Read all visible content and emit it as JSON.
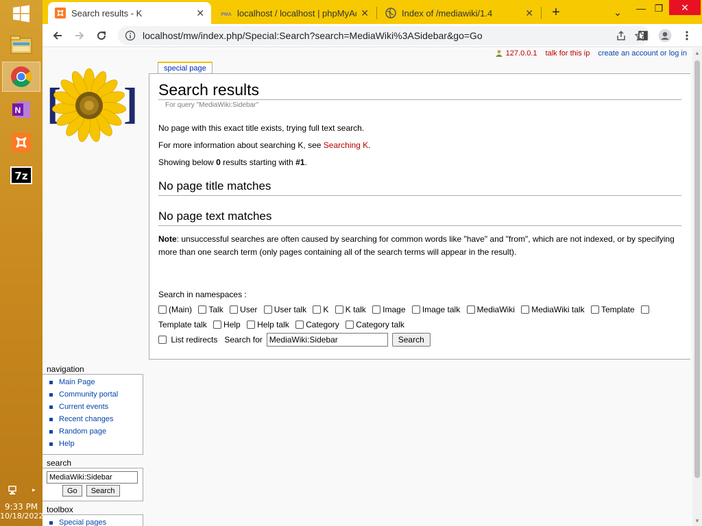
{
  "taskbar": {
    "time": "9:33 PM",
    "date": "10/18/2022",
    "apps": [
      {
        "name": "File Explorer",
        "icon": "file-explorer-icon"
      },
      {
        "name": "Google Chrome",
        "icon": "chrome-icon",
        "active": true
      },
      {
        "name": "OneNote",
        "icon": "onenote-icon"
      },
      {
        "name": "XAMPP",
        "icon": "xampp-icon"
      },
      {
        "name": "7-Zip",
        "icon": "7zip-icon",
        "label": "7z"
      }
    ]
  },
  "browser": {
    "tabs": [
      {
        "title": "Search results - K",
        "active": true
      },
      {
        "title": "localhost / localhost | phpMyAdmin",
        "active": false
      },
      {
        "title": "Index of /mediawiki/1.4",
        "active": false
      }
    ],
    "new_tab": "+",
    "address": "localhost/mw/index.php/Special:Search?search=MediaWiki%3ASidebar&go=Go"
  },
  "personal": {
    "ip": "127.0.0.1",
    "talk": "talk for this ip",
    "login": "create an account or log in"
  },
  "tab_label": "special page",
  "content": {
    "title": "Search results",
    "subtitle": "For query \"MediaWiki:Sidebar\"",
    "p1": "No page with this exact title exists, trying full text search.",
    "p2_prefix": "For more information about searching K, see ",
    "p2_link": "Searching K",
    "p2_suffix": ".",
    "p3_prefix": "Showing below ",
    "p3_count": "0",
    "p3_middle": " results starting with ",
    "p3_start": "#1",
    "p3_suffix": ".",
    "h_title": "No page title matches",
    "h_text": "No page text matches",
    "note_label": "Note",
    "note_text": ": unsuccessful searches are often caused by searching for common words like \"have\" and \"from\", which are not indexed, or by specifying more than one search term (only pages containing all of the search terms will appear in the result).",
    "ns_label": "Search in namespaces :",
    "namespaces": [
      "(Main)",
      "Talk",
      "User",
      "User talk",
      "K",
      "K talk",
      "Image",
      "Image talk",
      "MediaWiki",
      "MediaWiki talk",
      "Template",
      "Template talk",
      "Help",
      "Help talk",
      "Category",
      "Category talk"
    ],
    "list_redirects": "List redirects",
    "search_for": "Search for",
    "search_value": "MediaWiki:Sidebar",
    "search_button": "Search"
  },
  "sidebar": {
    "navigation_title": "navigation",
    "nav_items": [
      "Main Page",
      "Community portal",
      "Current events",
      "Recent changes",
      "Random page",
      "Help"
    ],
    "search_title": "search",
    "search_value": "MediaWiki:Sidebar",
    "go_button": "Go",
    "search_button": "Search",
    "toolbox_title": "toolbox",
    "toolbox_items": [
      "Special pages"
    ]
  }
}
